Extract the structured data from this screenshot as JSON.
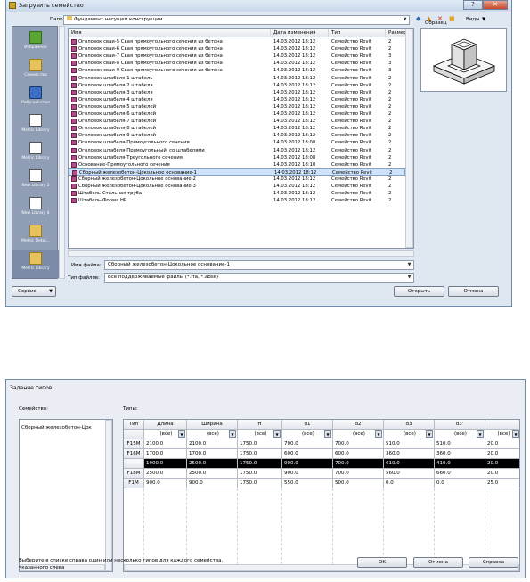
{
  "dialog1": {
    "title": "Загрузить семейство",
    "window_buttons": [
      "?",
      "✕"
    ],
    "folder_label": "Папка:",
    "folder_value": "Фундамент несущей конструкции",
    "toolbar": {
      "back": "◆",
      "up": "▲",
      "delete": "✕",
      "new_folder": "■",
      "views": "Виды"
    },
    "preview_label": "Образец",
    "places": [
      {
        "label": "Избранное",
        "icon": "star"
      },
      {
        "label": "Семейства",
        "icon": "folder"
      },
      {
        "label": "Рабочий стол",
        "icon": "desk"
      },
      {
        "label": "Metric Library",
        "icon": "white"
      },
      {
        "label": "Metric Library",
        "icon": "white"
      },
      {
        "label": "New Library 2",
        "icon": "white"
      },
      {
        "label": "New Library 4",
        "icon": "white"
      },
      {
        "label": "Metric Detai...",
        "icon": "folder"
      },
      {
        "label": "Metric Library",
        "icon": "folder"
      }
    ],
    "columns": [
      "Имя",
      "Дата изменения",
      "Тип",
      "Размер"
    ],
    "files": [
      {
        "name": "Оголовок сваи-5 Свая прямоугольного сечения из бетона",
        "date": "14.03.2012 18:12",
        "type": "Семейство Revit",
        "size": "2"
      },
      {
        "name": "Оголовок сваи-6 Свая прямоугольного сечения из бетона",
        "date": "14.03.2012 18:12",
        "type": "Семейство Revit",
        "size": "2"
      },
      {
        "name": "Оголовок сваи-7 Свая прямоугольного сечения из бетона",
        "date": "14.03.2012 18:12",
        "type": "Семейство Revit",
        "size": "3"
      },
      {
        "name": "Оголовок сваи-8 Свая прямоугольного сечения из бетона",
        "date": "14.03.2012 18:12",
        "type": "Семейство Revit",
        "size": "3"
      },
      {
        "name": "Оголовок сваи-9 Свая прямоугольного сечения из бетона",
        "date": "14.03.2012 18:12",
        "type": "Семейство Revit",
        "size": "3"
      },
      {
        "name": "Оголовок штабеля-1 штабель",
        "date": "14.03.2012 18:12",
        "type": "Семейство Revit",
        "size": "2"
      },
      {
        "name": "Оголовок штабеля-2 штабеля",
        "date": "14.03.2012 18:12",
        "type": "Семейство Revit",
        "size": "2"
      },
      {
        "name": "Оголовок штабеля-3 штабеля",
        "date": "14.03.2012 18:12",
        "type": "Семейство Revit",
        "size": "2"
      },
      {
        "name": "Оголовок штабеля-4 штабеля",
        "date": "14.03.2012 18:12",
        "type": "Семейство Revit",
        "size": "2"
      },
      {
        "name": "Оголовок штабеля-5 штабелей",
        "date": "14.03.2012 18:12",
        "type": "Семейство Revit",
        "size": "2"
      },
      {
        "name": "Оголовок штабеля-6 штабелей",
        "date": "14.03.2012 18:12",
        "type": "Семейство Revit",
        "size": "2"
      },
      {
        "name": "Оголовок штабеля-7 штабелей",
        "date": "14.03.2012 18:12",
        "type": "Семейство Revit",
        "size": "2"
      },
      {
        "name": "Оголовок штабеля-8 штабелей",
        "date": "14.03.2012 18:12",
        "type": "Семейство Revit",
        "size": "2"
      },
      {
        "name": "Оголовок штабеля-9 штабелей",
        "date": "14.03.2012 18:12",
        "type": "Семейство Revit",
        "size": "2"
      },
      {
        "name": "Оголовок штабеля-Прямоугольного сечения",
        "date": "14.03.2012 18:08",
        "type": "Семейство Revit",
        "size": "2"
      },
      {
        "name": "Оголовок штабеля-Прямоугольный, со штабелями",
        "date": "14.03.2012 18:12",
        "type": "Семейство Revit",
        "size": "2"
      },
      {
        "name": "Оголовок штабеля-Треугольного сечения",
        "date": "14.03.2012 18:08",
        "type": "Семейство Revit",
        "size": "2"
      },
      {
        "name": "Основание-Прямоугольного сечения",
        "date": "14.03.2012 18:10",
        "type": "Семейство Revit",
        "size": "2"
      },
      {
        "name": "Сборный железобетон-Цокольное основание-1",
        "date": "14.03.2012 18:12",
        "type": "Семейство Revit",
        "size": "2"
      },
      {
        "name": "Сборный железобетон-Цокольное основание-2",
        "date": "14.03.2012 18:12",
        "type": "Семейство Revit",
        "size": "2"
      },
      {
        "name": "Сборный железобетон-Цокольное основание-3",
        "date": "14.03.2012 18:12",
        "type": "Семейство Revit",
        "size": "2"
      },
      {
        "name": "Штабель-Стальная труба",
        "date": "14.03.2012 18:12",
        "type": "Семейство Revit",
        "size": "2"
      },
      {
        "name": "Штабель-Форма HP",
        "date": "14.03.2012 18:12",
        "type": "Семейство Revit",
        "size": "2"
      }
    ],
    "selected_file": "Сборный железобетон-Цокольное основание-1",
    "filename_label": "Имя файла:",
    "filename_value": "Сборный железобетон-Цокольное основание-1",
    "filetype_label": "Тип файлов:",
    "filetype_value": "Все поддерживаемые файлы  (*.rfa, *.adsk)",
    "service_button": "Сервис",
    "open_button": "Открыть",
    "cancel_button": "Отмена"
  },
  "dialog2": {
    "title": "Задание типов",
    "family_label": "Семейство:",
    "types_label": "Типы:",
    "family_item": "Сборный железобетон-Цок",
    "columns": [
      "Тип",
      "Длина",
      "Ширина",
      "H",
      "d1",
      "d2",
      "d3",
      "d3'",
      ""
    ],
    "filter_value": "(все)",
    "rows": [
      {
        "type": "F15M",
        "values": [
          "2100.0",
          "2100.0",
          "1750.0",
          "700.0",
          "700.0",
          "510.0",
          "510.0",
          "20.0"
        ]
      },
      {
        "type": "F16M",
        "values": [
          "1700.0",
          "1700.0",
          "1750.0",
          "600.0",
          "600.0",
          "360.0",
          "360.0",
          "20.0"
        ]
      },
      {
        "type": "F17M",
        "values": [
          "1900.0",
          "2500.0",
          "1750.0",
          "900.0",
          "700.0",
          "610.0",
          "410.0",
          "20.0"
        ]
      },
      {
        "type": "F18M",
        "values": [
          "2500.0",
          "2500.0",
          "1750.0",
          "900.0",
          "700.0",
          "560.0",
          "660.0",
          "20.0"
        ]
      },
      {
        "type": "F1M",
        "values": [
          "900.0",
          "900.0",
          "1750.0",
          "550.0",
          "500.0",
          "0.0",
          "0.0",
          "25.0"
        ]
      }
    ],
    "selected_row": "F17M",
    "hint": "Выберите в списке справа один или несколько типов для каждого семейства, указанного слева",
    "ok_button": "OK",
    "cancel_button": "Отмена",
    "help_button": "Справка"
  }
}
